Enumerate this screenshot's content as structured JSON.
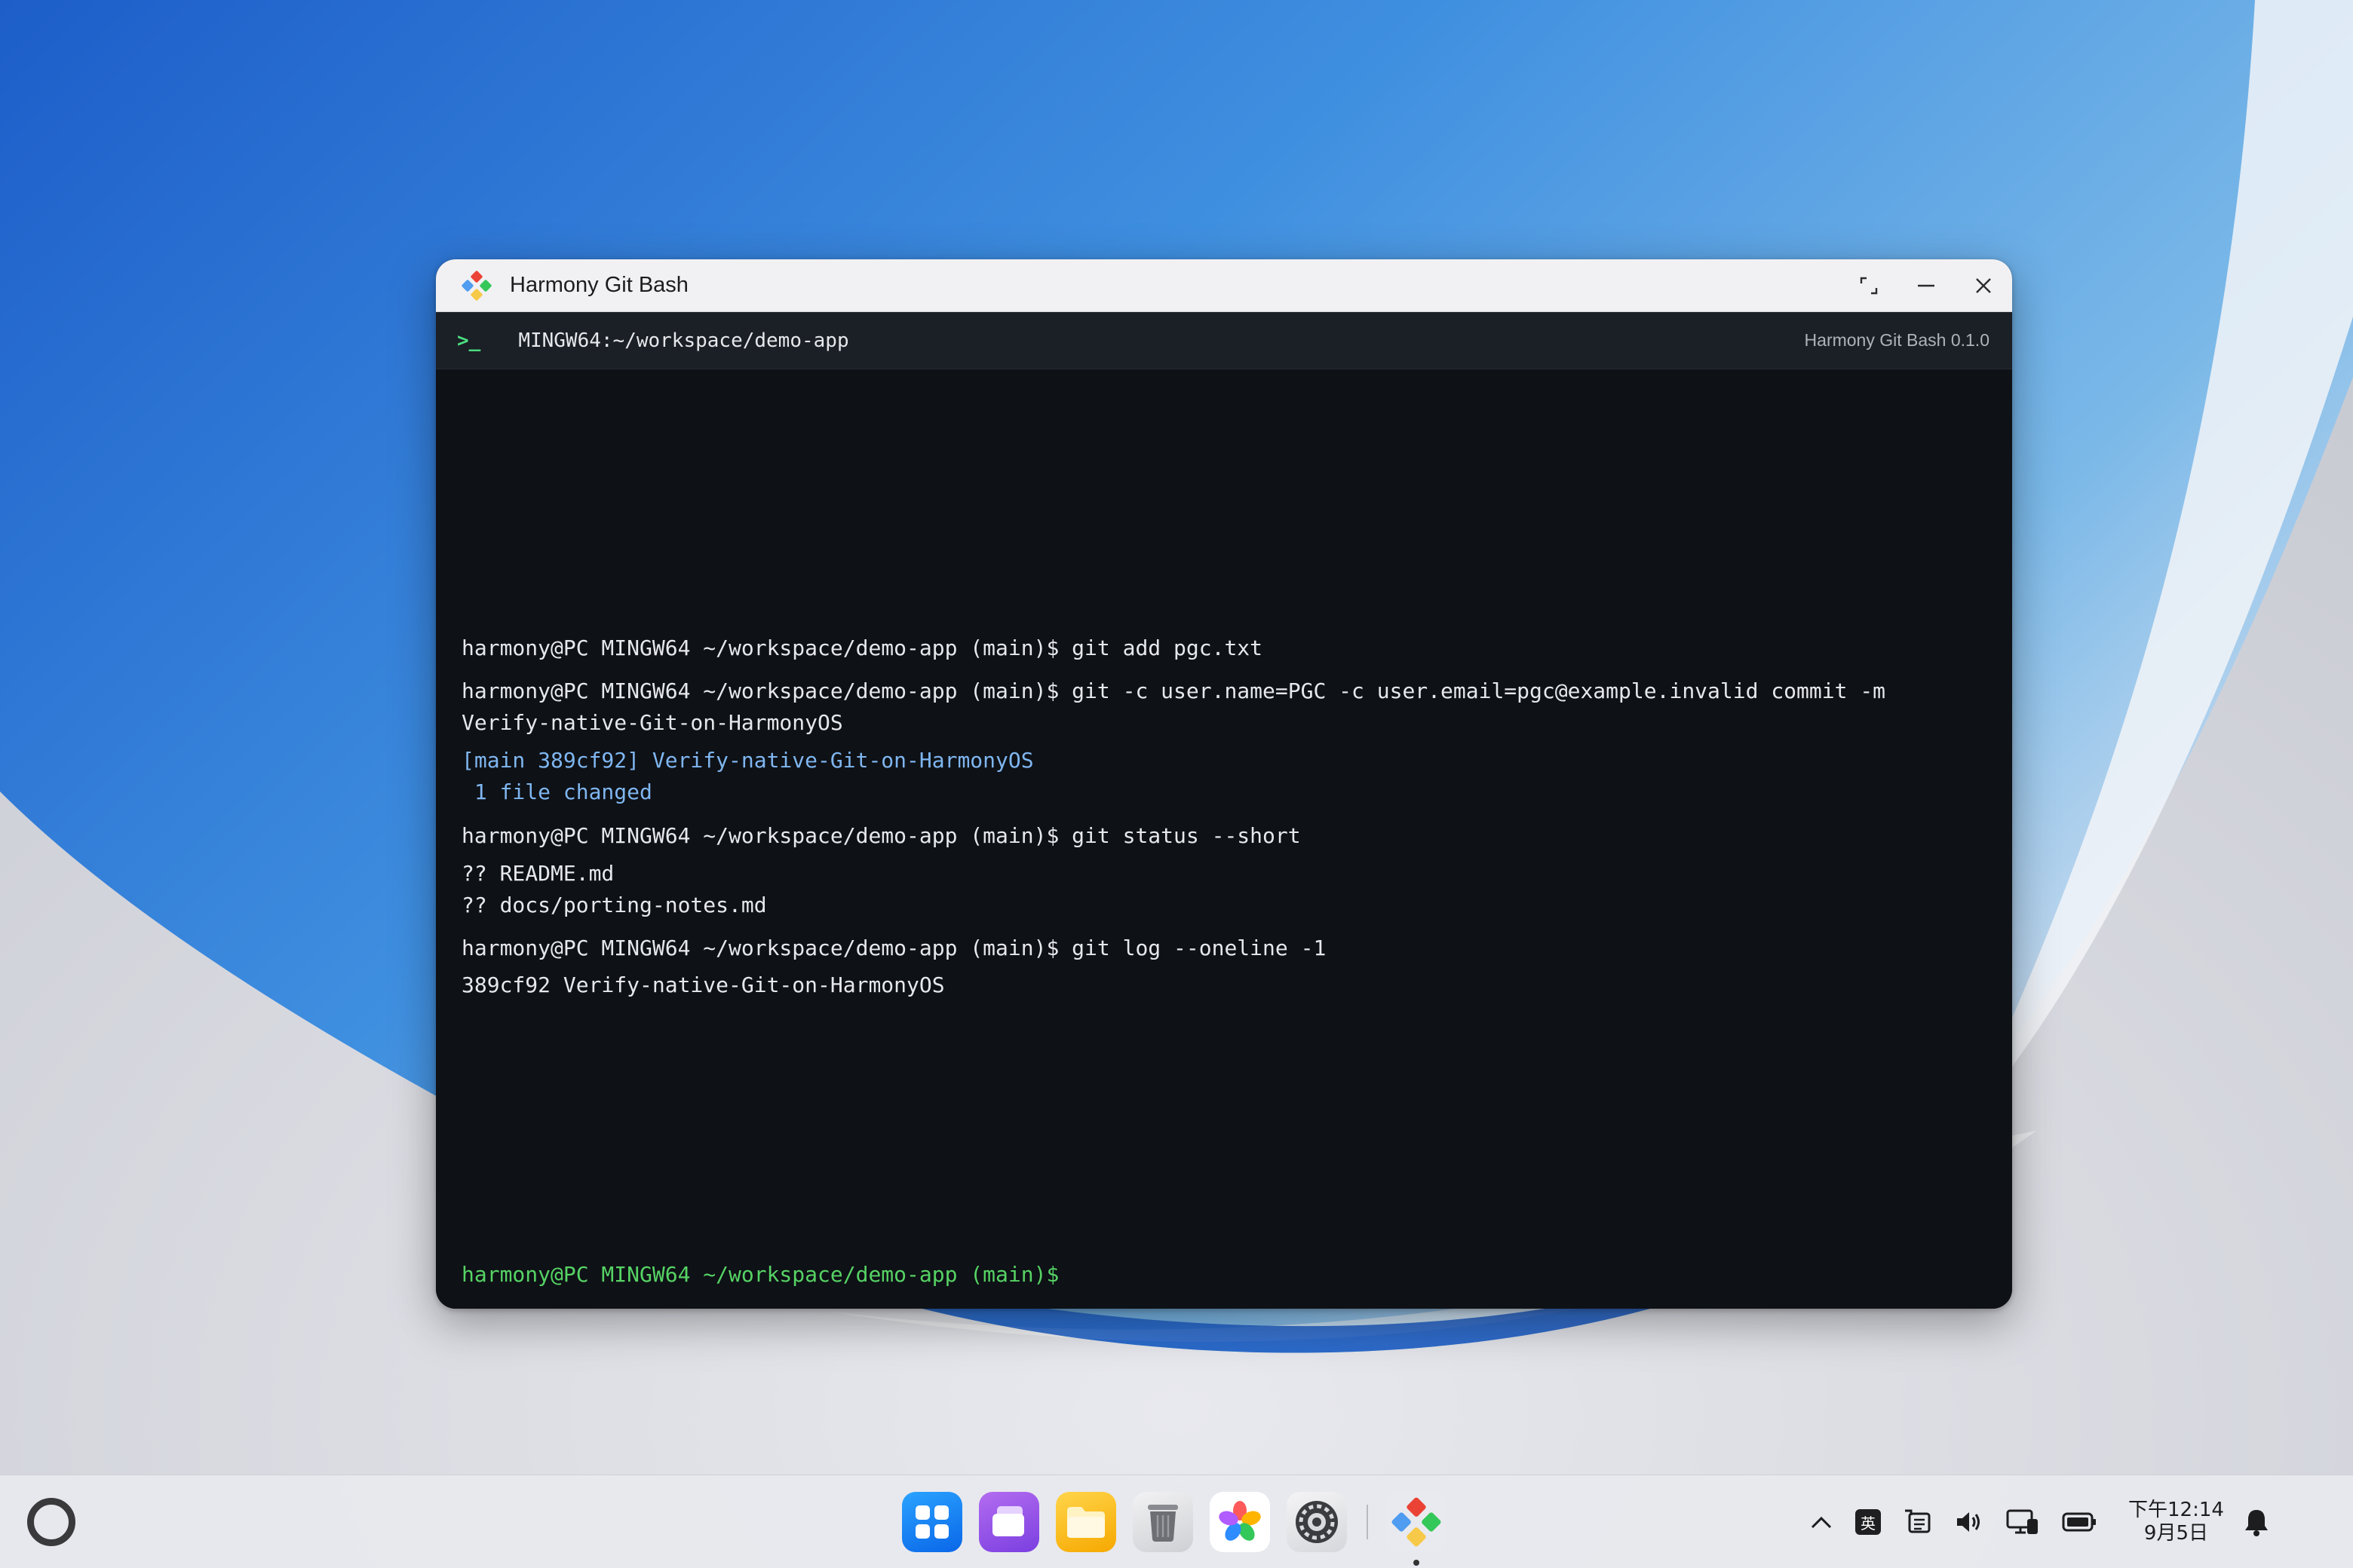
{
  "window": {
    "title": "Harmony Git Bash",
    "tab_path": "MINGW64:~/workspace/demo-app",
    "prompt_icon": ">_",
    "version": "Harmony Git Bash 0.1.0",
    "controls": [
      "maximize-icon",
      "minimize-icon",
      "close-icon"
    ]
  },
  "terminal": {
    "lines": [
      {
        "text": "harmony@PC MINGW64 ~/workspace/demo-app (main)$ git add pgc.txt",
        "style": "cmd"
      },
      {
        "text": "harmony@PC MINGW64 ~/workspace/demo-app (main)$ git -c user.name=PGC -c user.email=pgc@example.invalid commit -m",
        "style": "cmd"
      },
      {
        "text": "Verify-native-Git-on-HarmonyOS",
        "style": "cmd"
      },
      {
        "text": "[main 389cf92] Verify-native-Git-on-HarmonyOS",
        "style": "info"
      },
      {
        "text": " 1 file changed",
        "style": "info"
      },
      {
        "text": "harmony@PC MINGW64 ~/workspace/demo-app (main)$ git status --short",
        "style": "cmd"
      },
      {
        "text": "?? README.md",
        "style": "cmd"
      },
      {
        "text": "?? docs/porting-notes.md",
        "style": "cmd"
      },
      {
        "text": "harmony@PC MINGW64 ~/workspace/demo-app (main)$ git log --oneline -1",
        "style": "cmd"
      },
      {
        "text": "389cf92 Verify-native-Git-on-HarmonyOS",
        "style": "cmd"
      },
      {
        "text": "harmony@PC MINGW64 ~/workspace/demo-app (main)$",
        "style": "green"
      }
    ]
  },
  "taskbar": {
    "dock_icons": [
      "app-grid-icon",
      "multitask-icon",
      "files-icon",
      "trash-icon",
      "gallery-icon",
      "settings-icon",
      "git-bash-icon"
    ],
    "tray": {
      "chevron": "chevron-up-icon",
      "ime_label": "英",
      "icons": [
        "clipboard-icon",
        "volume-icon",
        "screen-cast-icon",
        "battery-icon",
        "bell-icon"
      ]
    },
    "clock_time": "下午12:14",
    "clock_date": "9月5日"
  },
  "colors": {
    "prompt_green": "#56d364",
    "info_blue": "#7fb6f0",
    "terminal_bg": "#0e1116",
    "tabbar_bg": "#1b1f26"
  }
}
